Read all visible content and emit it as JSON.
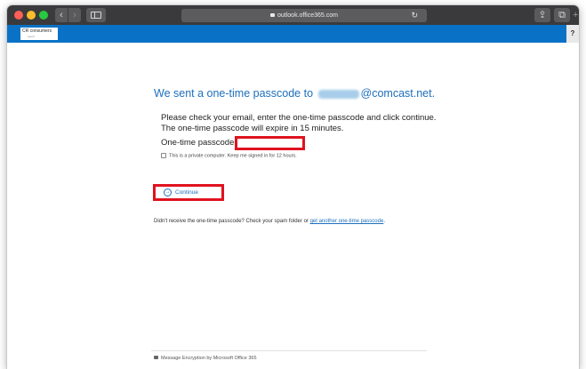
{
  "browser": {
    "address": "outlook.office365.com",
    "nav_back": "‹",
    "nav_forward": "›",
    "reload_symbol": "↻",
    "share_symbol": "⇪",
    "tabs_symbol": "⧉",
    "new_tab_symbol": "+"
  },
  "header": {
    "logo_text": "CR consumers",
    "logo_subtext": "report",
    "help_label": "?",
    "accent_color": "#0a72c6"
  },
  "main": {
    "headline_prefix": "We sent a one-time passcode to",
    "headline_suffix": "@comcast.net.",
    "instructions_line1": "Please check your email, enter the one-time passcode and click continue.",
    "instructions_line2": "The one-time passcode will expire in 15 minutes.",
    "otp_label": "One-time passcode",
    "otp_value": "",
    "checkbox_label": "This is a private computer. Keep me signed in for 12 hours.",
    "continue_label": "Continue",
    "continue_icon": "→",
    "resend_text": "Didn't receive the one-time passcode? Check your spam folder or",
    "resend_link": "get another one-time passcode",
    "resend_end": "."
  },
  "footer": {
    "text": "Message Encryption by Microsoft Office 365"
  },
  "colors": {
    "highlight_red": "#e0121f",
    "link_blue": "#1d6fbc"
  }
}
